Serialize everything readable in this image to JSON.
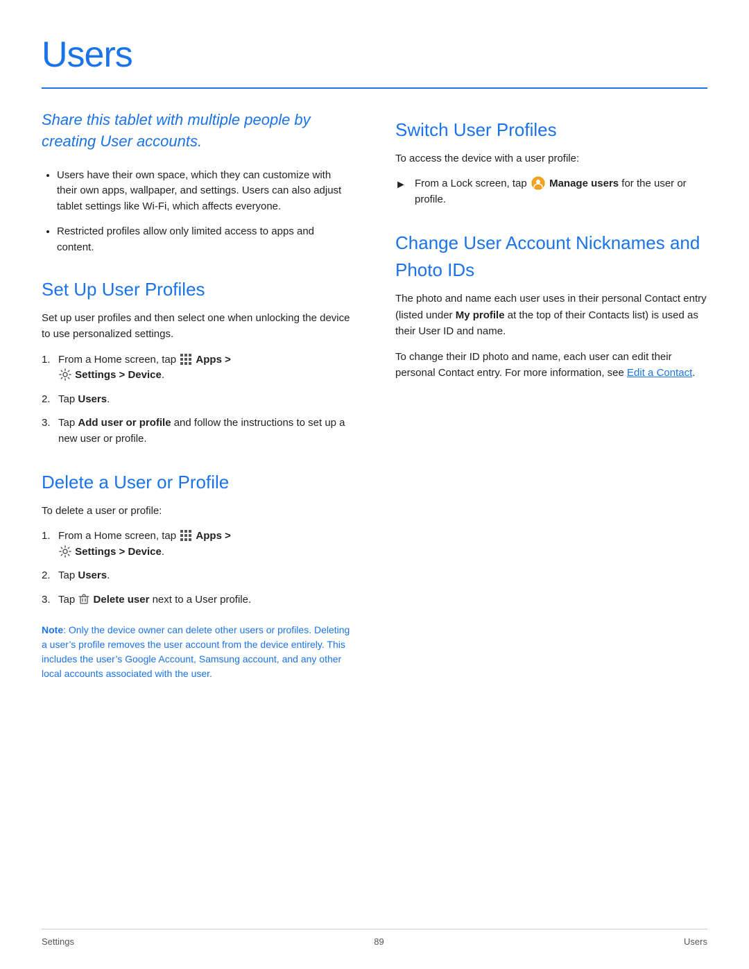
{
  "page": {
    "title": "Users",
    "footer": {
      "left": "Settings",
      "center": "89",
      "right": "Users"
    }
  },
  "left_col": {
    "intro": "Share this tablet with multiple people by creating User accounts.",
    "bullets": [
      "Users have their own space, which they can customize with their own apps, wallpaper, and settings. Users can also adjust tablet settings like Wi-Fi, which affects everyone.",
      "Restricted profiles allow only limited access to apps and content."
    ],
    "set_up": {
      "title": "Set Up User Profiles",
      "body": "Set up user profiles and then select one when unlocking the device to use personalized settings.",
      "steps": [
        {
          "num": "1.",
          "text_before": "From a Home screen, tap",
          "apps_label": "Apps >",
          "settings_label": "Settings > Device",
          "has_settings_icon": true,
          "has_apps_icon": true,
          "line2": "Settings > Device."
        },
        {
          "num": "2.",
          "text": "Tap ",
          "bold": "Users",
          "text2": "."
        },
        {
          "num": "3.",
          "text": "Tap ",
          "bold": "Add user or profile",
          "text2": " and follow the instructions to set up a new user or profile."
        }
      ]
    },
    "delete": {
      "title": "Delete a User or Profile",
      "body": "To delete a user or profile:",
      "steps": [
        {
          "num": "1.",
          "text_before": "From a Home screen, tap",
          "apps_label": "Apps >",
          "settings_label": "Settings > Device.",
          "has_settings_icon": true,
          "has_apps_icon": true
        },
        {
          "num": "2.",
          "text": "Tap ",
          "bold": "Users",
          "text2": "."
        },
        {
          "num": "3.",
          "text": "Tap ",
          "bold": "Delete user",
          "text2": " next to a User profile.",
          "has_trash_icon": true
        }
      ],
      "note_label": "Note",
      "note_text": ": Only the device owner can delete other users or profiles. Deleting a user’s profile removes the user account from the device entirely. This includes the user’s Google Account, Samsung account, and any other local accounts associated with the user."
    }
  },
  "right_col": {
    "switch": {
      "title": "Switch User Profiles",
      "body": "To access the device with a user profile:",
      "step": {
        "text_before": "From a Lock screen, tap",
        "manage_label": "Manage users",
        "text_after": "for the user or profile."
      }
    },
    "change": {
      "title": "Change User Account Nicknames and Photo IDs",
      "para1": "The photo and name each user uses in their personal Contact entry (listed under My profile at the top of their Contacts list) is used as their User ID and name.",
      "my_profile_bold": "My profile",
      "para2": "To change their ID photo and name, each user can edit their personal Contact entry. For more information, see ",
      "link_text": "Edit a Contact",
      "para2_end": "."
    }
  }
}
